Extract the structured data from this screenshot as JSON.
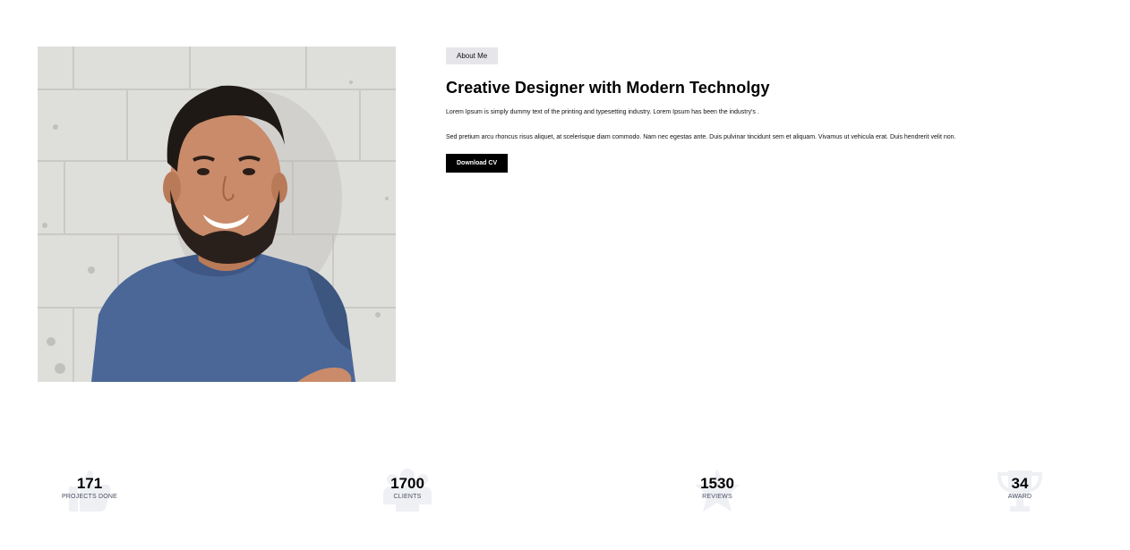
{
  "about": {
    "tag": "About Me",
    "headline": "Creative Designer with Modern Technolgy",
    "paragraph_1": "Lorem Ipsum is simply dummy text of the printing and typesetting industry. Lorem Ipsum has been the industry's .",
    "paragraph_2": "Sed pretium arcu rhoncus risus aliquet, at scelerisque diam commodo. Nam nec egestas ante. Duis pulvinar tincidunt sem et aliquam. Vivamus ut vehicula erat. Duis hendrerit velit non.",
    "cv_button": "Download CV"
  },
  "stats": [
    {
      "value": "171",
      "label": "PROJECTS DONE",
      "icon": "thumbs-up-icon"
    },
    {
      "value": "1700",
      "label": "CLIENTS",
      "icon": "users-icon"
    },
    {
      "value": "1530",
      "label": "REVIEWS",
      "icon": "star-icon"
    },
    {
      "value": "34",
      "label": "AWARD",
      "icon": "trophy-icon"
    }
  ],
  "colors": {
    "tag_bg": "#e6e6ea",
    "button_bg": "#000000",
    "button_text": "#ffffff",
    "stat_label": "#4a4f63",
    "stat_icon": "#eef0f4",
    "shirt": "#4a6797"
  }
}
